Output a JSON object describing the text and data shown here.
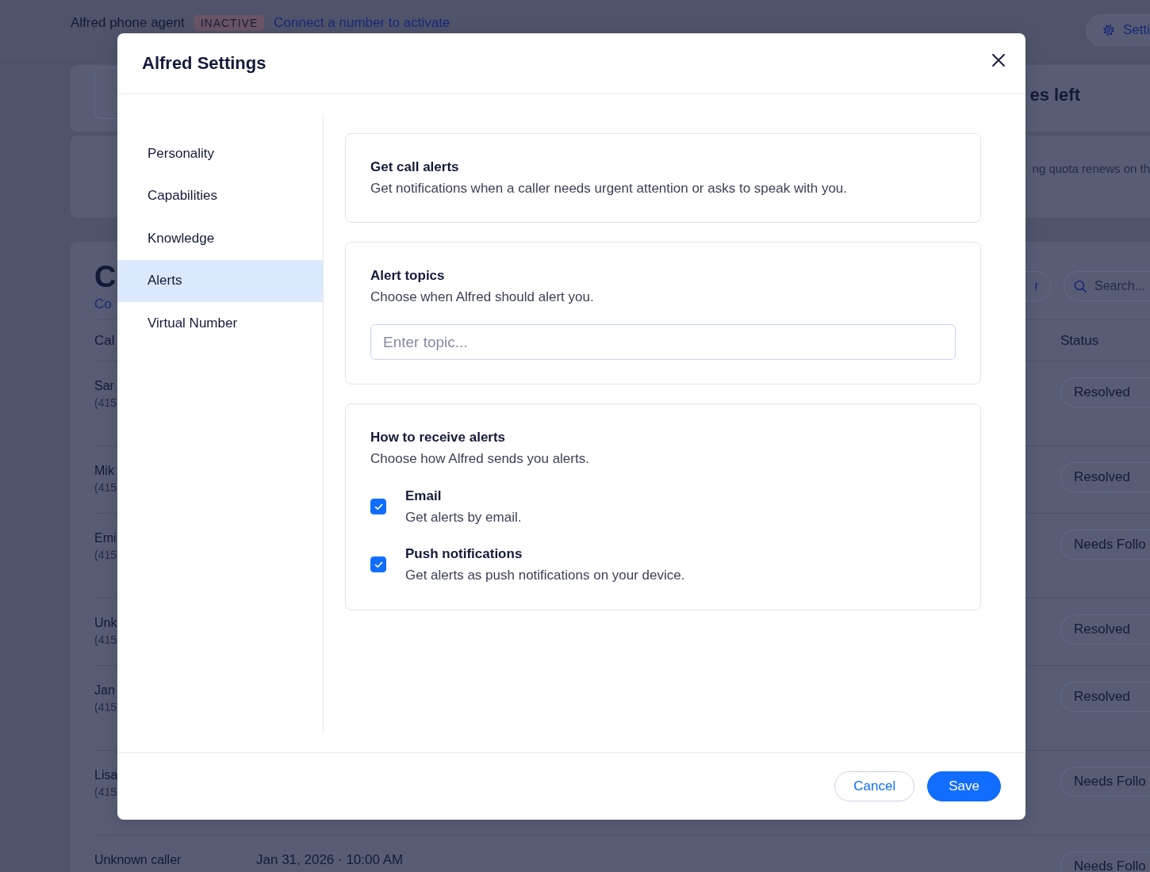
{
  "page": {
    "header": {
      "title": "Alfred phone agent",
      "status_badge": "INACTIVE",
      "link": "Connect a number to activate",
      "settings_button": "Setti"
    },
    "usage": {
      "heading": "es left",
      "note": "ng quota renews on th"
    },
    "calls": {
      "title": "C",
      "link": "Co",
      "filter_button": "r",
      "search": {
        "placeholder": "Search..."
      },
      "columns": [
        "Cal",
        "Status"
      ],
      "rows": [
        {
          "caller": "Sar",
          "phone": "(415",
          "status": "Resolved"
        },
        {
          "caller": "Mik",
          "phone": "(415",
          "status": "Resolved"
        },
        {
          "caller": "Emi",
          "phone": "(415",
          "status": "Needs Follo"
        },
        {
          "caller": "Unk",
          "phone": "(415",
          "status": "Resolved"
        },
        {
          "caller": "Jan",
          "phone": "(415",
          "status": "Resolved"
        },
        {
          "caller": "Lisa",
          "phone": "(415",
          "status": "Needs Follo"
        },
        {
          "caller": "Unknown caller",
          "time": "Jan 31, 2026 · 10:00 AM",
          "status": "Needs Follo"
        }
      ]
    }
  },
  "dialog": {
    "title": "Alfred Settings",
    "nav": [
      {
        "label": "Personality",
        "selected": false
      },
      {
        "label": "Capabilities",
        "selected": false
      },
      {
        "label": "Knowledge",
        "selected": false
      },
      {
        "label": "Alerts",
        "selected": true
      },
      {
        "label": "Virtual Number",
        "selected": false
      }
    ],
    "sections": [
      {
        "kind": "info",
        "title": "Get call alerts",
        "description": "Get notifications when a caller needs urgent attention or asks to speak with you."
      },
      {
        "kind": "input",
        "title": "Alert topics",
        "description": "Choose when Alfred should alert you.",
        "field": {
          "placeholder": "Enter topic..."
        }
      },
      {
        "kind": "checklist",
        "title": "How to receive alerts",
        "description": "Choose how Alfred sends you alerts.",
        "options": [
          {
            "label": "Email",
            "description": "Get alerts by email.",
            "checked": true
          },
          {
            "label": "Push notifications",
            "description": "Get alerts as push notifications on your device.",
            "checked": true
          }
        ]
      }
    ],
    "buttons": [
      {
        "kind": "secondary",
        "label": "Cancel"
      },
      {
        "kind": "primary",
        "label": "Save"
      }
    ]
  }
}
